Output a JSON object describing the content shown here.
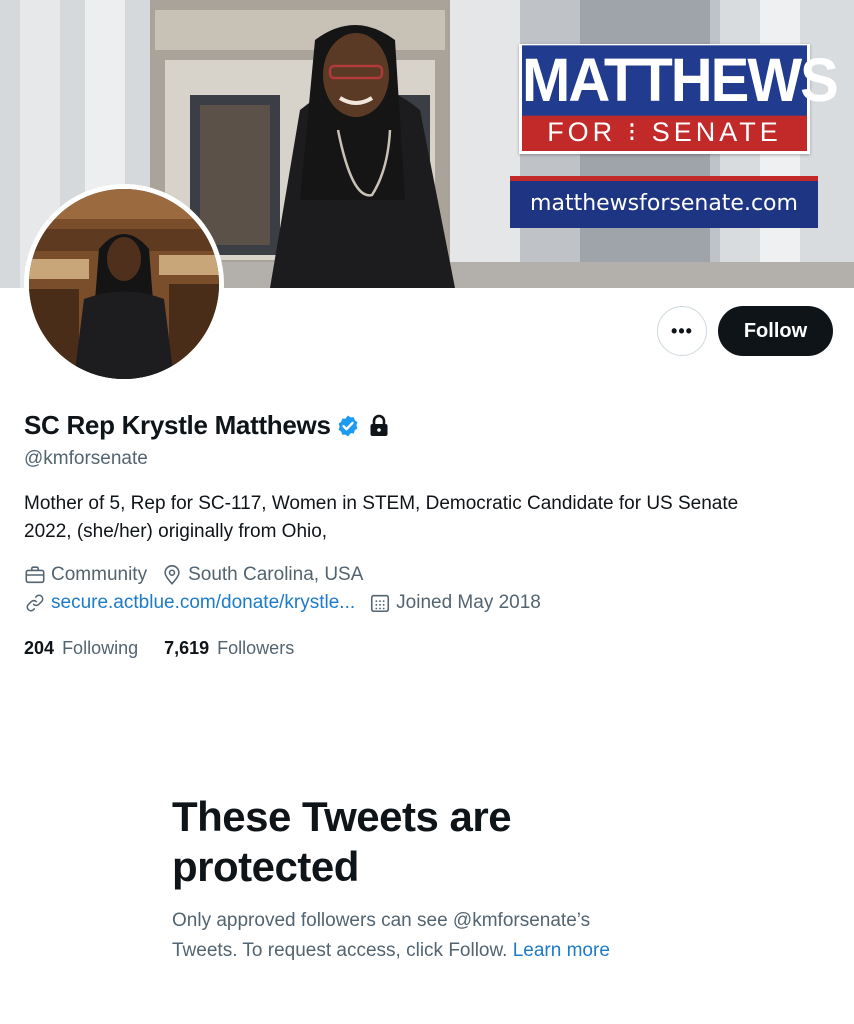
{
  "banner": {
    "logo_top": "MATTHEWS",
    "logo_bottom": "FOR ⁝ SENATE",
    "website": "matthewsforsenate.com"
  },
  "actions": {
    "more_label": "•••",
    "follow_label": "Follow"
  },
  "profile": {
    "display_name": "SC Rep Krystle Matthews",
    "handle": "@kmforsenate",
    "bio_line1": "Mother of 5, Rep for SC-117, Women in STEM, Democratic Candidate for US Senate",
    "bio_line2": "2022, (she/her) originally from Ohio,",
    "category": "Community",
    "location": "South Carolina, USA",
    "link": "secure.actblue.com/donate/krystle...",
    "joined": "Joined May 2018",
    "following_count": "204",
    "following_label": "Following",
    "followers_count": "7,619",
    "followers_label": "Followers"
  },
  "protected": {
    "heading_line1": "These Tweets are",
    "heading_line2": "protected",
    "text_line1": "Only approved followers can see @kmforsenate’s",
    "text_line2": "Tweets. To request access, click Follow.",
    "learn_more": "Learn more"
  },
  "colors": {
    "accent_blue": "#1d7bc9",
    "verified_blue": "#1d9bf0",
    "logo_navy": "#213c8e",
    "logo_red": "#c22a2a"
  },
  "icons": [
    "verified-badge-icon",
    "lock-icon",
    "briefcase-icon",
    "location-pin-icon",
    "link-icon",
    "calendar-icon"
  ]
}
